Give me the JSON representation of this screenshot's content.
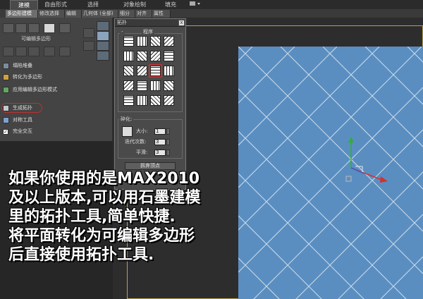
{
  "ribbon": {
    "top_tabs": [
      "建模",
      "自由形式",
      "选择",
      "对象绘制",
      "填充"
    ],
    "sub_tabs": [
      "多边形建模",
      "修改选择",
      "编辑",
      "几何体 (全部)",
      "细分",
      "对齐",
      "属性"
    ]
  },
  "left_panel": {
    "editable_poly_label": "可编辑多边形",
    "items": [
      {
        "label": "塌陷堆叠",
        "icon": "stack-icon"
      },
      {
        "label": "转化为多边形",
        "icon": "convert-icon"
      },
      {
        "label": "应用编辑多边形模式",
        "icon": "edit-poly-icon"
      },
      {
        "label": "生成拓扑",
        "icon": "topology-icon"
      },
      {
        "label": "对称工具",
        "icon": "symmetry-icon"
      },
      {
        "label": "完全交互",
        "icon": "checkbox-icon"
      }
    ]
  },
  "topology_panel": {
    "title": "拓扑",
    "close": "x",
    "procedure_label": "程序",
    "collapse": "-",
    "break_label": "碎化:",
    "size_label": "大小:",
    "size_value": "1",
    "iterations_label": "迭代次数:",
    "iterations_value": "3",
    "smooth_label": "平滑:",
    "smooth_value": "3",
    "button_label": "拆弃顶点"
  },
  "caption": {
    "line1": "如果你使用的是MAX2010",
    "line2": "及以上版本,可以用石墨建模",
    "line3": "里的拓扑工具,简单快捷.",
    "line4": "将平面转化为可编辑多边形",
    "line5": "后直接使用拓扑工具."
  },
  "colors": {
    "plane": "#5b8ec0",
    "highlight": "#c03030",
    "axis_x": "#d43030",
    "axis_y": "#30b030",
    "axis_z": "#3060d0"
  }
}
